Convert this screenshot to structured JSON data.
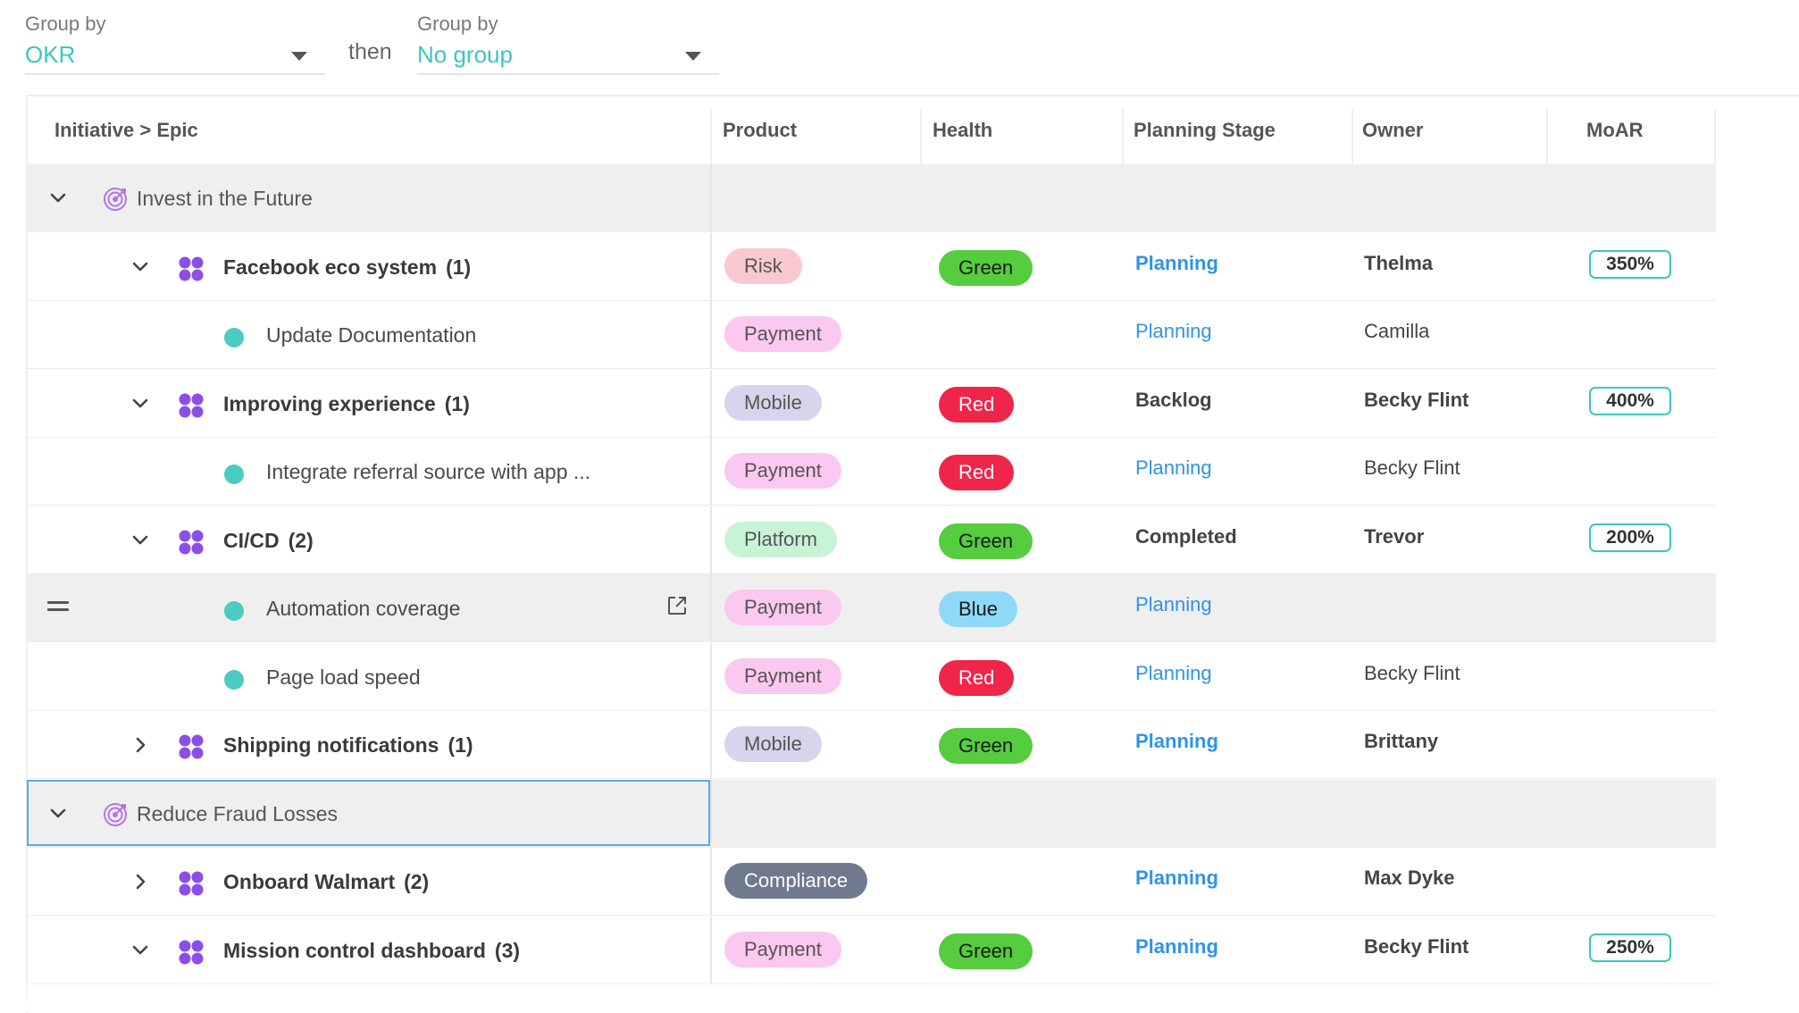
{
  "groupby": {
    "first": {
      "label": "Group by",
      "value": "OKR"
    },
    "connector": "then",
    "second": {
      "label": "Group by",
      "value": "No group"
    }
  },
  "table": {
    "columns": [
      "Initiative > Epic",
      "Product",
      "Health",
      "Planning Stage",
      "Owner",
      "MoAR"
    ],
    "rows": [
      {
        "type": "group",
        "name": "Invest in the Future",
        "expanded": true
      },
      {
        "type": "epic",
        "name": "Facebook eco system",
        "count": "(1)",
        "expanded": true,
        "product": "Risk",
        "health": "Green",
        "stage": "Planning",
        "owner": "Thelma",
        "moar": "350%"
      },
      {
        "type": "story",
        "name": "Update Documentation",
        "product": "Payment",
        "health": "",
        "stage": "Planning",
        "owner": "Camilla",
        "moar": ""
      },
      {
        "type": "epic",
        "name": "Improving experience",
        "count": "(1)",
        "expanded": true,
        "product": "Mobile",
        "health": "Red",
        "stage": "Backlog",
        "owner": "Becky Flint",
        "moar": "400%"
      },
      {
        "type": "story",
        "name": "Integrate referral source with app ...",
        "product": "Payment",
        "health": "Red",
        "stage": "Planning",
        "owner": "Becky Flint",
        "moar": ""
      },
      {
        "type": "epic",
        "name": "CI/CD",
        "count": "(2)",
        "expanded": true,
        "product": "Platform",
        "health": "Green",
        "stage": "Completed",
        "owner": "Trevor",
        "moar": "200%"
      },
      {
        "type": "story",
        "name": "Automation coverage",
        "product": "Payment",
        "health": "Blue",
        "stage": "Planning",
        "owner": "",
        "moar": "",
        "hover": true
      },
      {
        "type": "story",
        "name": "Page load speed",
        "product": "Payment",
        "health": "Red",
        "stage": "Planning",
        "owner": "Becky Flint",
        "moar": ""
      },
      {
        "type": "epic",
        "name": "Shipping notifications",
        "count": "(1)",
        "expanded": false,
        "product": "Mobile",
        "health": "Green",
        "stage": "Planning",
        "owner": "Brittany",
        "moar": ""
      },
      {
        "type": "group",
        "name": "Reduce Fraud Losses",
        "expanded": true,
        "selected": true
      },
      {
        "type": "epic",
        "name": "Onboard Walmart",
        "count": "(2)",
        "expanded": false,
        "product": "Compliance",
        "health": "",
        "stage": "Planning",
        "owner": "Max Dyke",
        "moar": ""
      },
      {
        "type": "epic",
        "name": "Mission control dashboard",
        "count": "(3)",
        "expanded": true,
        "product": "Payment",
        "health": "Green",
        "stage": "Planning",
        "owner": "Becky Flint",
        "moar": "250%"
      }
    ]
  },
  "product_colors": {
    "Risk": {
      "bg": "#f9c9cf",
      "fg": "#555555"
    },
    "Payment": {
      "bg": "#fbc8ef",
      "fg": "#555555"
    },
    "Mobile": {
      "bg": "#d9d3ec",
      "fg": "#555555"
    },
    "Platform": {
      "bg": "#c9f3d5",
      "fg": "#555555"
    },
    "Compliance": {
      "bg": "#6f7a8e",
      "fg": "#ffffff"
    }
  },
  "health_colors": {
    "Green": {
      "bg": "#56cc3f",
      "fg": "#1a1a1a"
    },
    "Red": {
      "bg": "#f0254a",
      "fg": "#ffffff"
    },
    "Blue": {
      "bg": "#8ed9f7",
      "fg": "#1a1a1a"
    }
  },
  "colors": {
    "accent": "#3ec4c4",
    "link": "#2f94e8",
    "group_row_bg": "#efefef",
    "initiative_icon": "#b774e6",
    "epic_icon": "#8c4fe6",
    "story_dot": "#4ccbc0",
    "selection_border": "#5aa9e6"
  },
  "icons": {
    "caret": "chevron-down-icon",
    "collapsed": "chevron-right-icon",
    "initiative": "target-icon",
    "epic": "four-dots-icon",
    "story": "dot-icon",
    "drag": "drag-handle-icon",
    "open": "open-external-icon"
  }
}
